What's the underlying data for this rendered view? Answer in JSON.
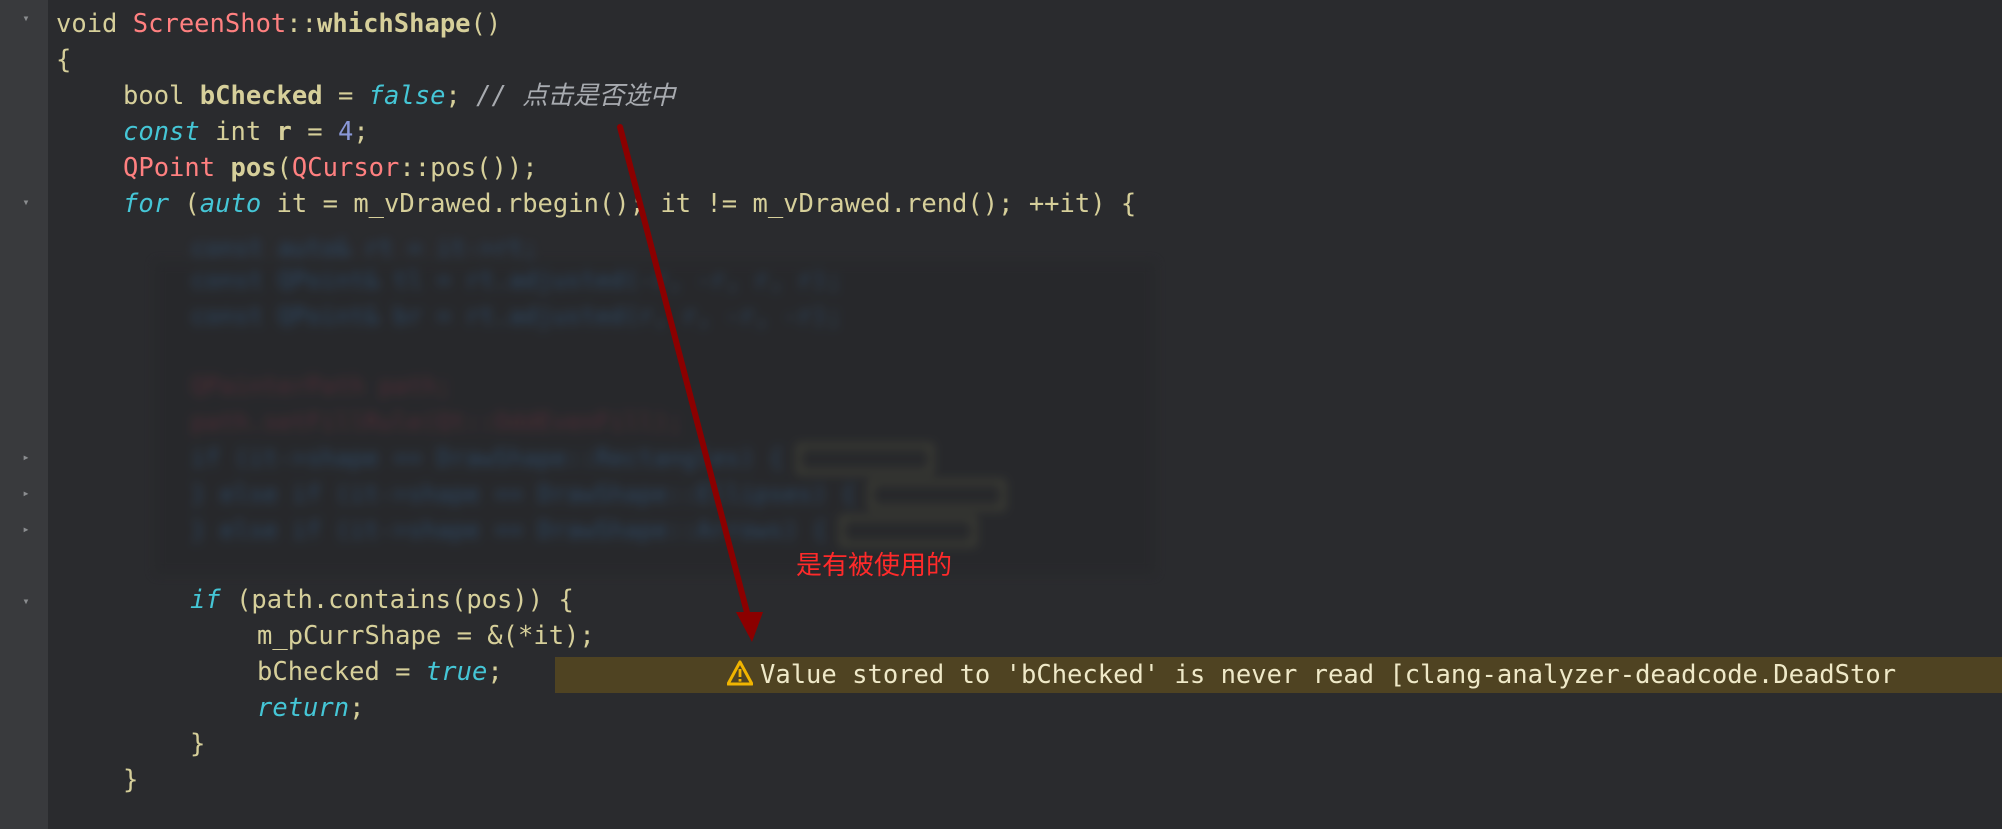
{
  "code": {
    "sig_void": "void ",
    "sig_class": "ScreenShot",
    "sig_sep": "::",
    "sig_fn": "whichShape",
    "sig_parens": "()",
    "open_brace": "{",
    "l3_type": "bool ",
    "l3_var": "bChecked",
    "l3_eq": " = ",
    "l3_val": "false",
    "l3_semi": "; ",
    "l3_comment": "// 点击是否选中",
    "l4_const": "const",
    "l4_int": " int ",
    "l4_var": "r",
    "l4_eq": " = ",
    "l4_num": "4",
    "l4_semi": ";",
    "l5_type": "QPoint",
    "l5_sp": " ",
    "l5_fn": "pos",
    "l5_open": "(",
    "l5_cursor": "QCursor",
    "l5_rest": "::pos());",
    "l6_for": "for",
    "l6_open": " (",
    "l6_auto": "auto",
    "l6_rest": " it = m_vDrawed.rbegin(); it != m_vDrawed.rend(); ++it) {",
    "l7_if": "if",
    "l7_rest": " (path.contains(pos)) {",
    "l8": "m_pCurrShape = &(*it);",
    "l9_var": "bChecked = ",
    "l9_val": "true",
    "l9_semi": ";",
    "l10": "return",
    "l10_semi": ";",
    "close_inner": "}",
    "close_for": "}"
  },
  "blurred": {
    "b1": "const auto& rt = it->rt;",
    "b2": "const QPoint& tl = rt.adjusted(-r, -r, r, r);",
    "b3": "const QPoint& br = rt.adjusted(r, r, -r, -r);",
    "b4": "QPainterPath path;",
    "b5": "path.setFillRule(Qt::OddEvenFill);",
    "b6": "if (it->shape == DrawShape::Rectangles) {",
    "b7": "} else if (it->shape == DrawShape::Ellipses) {",
    "b8": "} else if (it->shape == DrawShape::Arrows) {"
  },
  "annotation": {
    "note": "是有被使用的"
  },
  "warning": {
    "icon": "warning-triangle-icon",
    "text": "Value stored to 'bChecked' is never read [clang-analyzer-deadcode.DeadStor"
  },
  "colors": {
    "background": "#2a2b2e",
    "gutter": "#393a3d",
    "warning_bar": "#4f4322",
    "annotation_red": "#ff2a2a",
    "arrow": "#8b0000"
  }
}
